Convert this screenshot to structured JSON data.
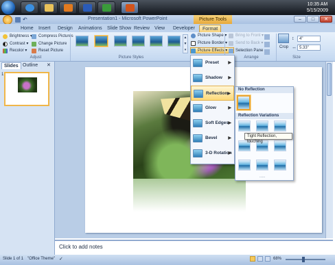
{
  "taskbar": {
    "time": "10:35 AM",
    "date": "5/15/2009"
  },
  "window": {
    "title": "Presentation1 - Microsoft PowerPoint",
    "contextual_tab_group": "Picture Tools"
  },
  "tabs": [
    {
      "label": "Home"
    },
    {
      "label": "Insert"
    },
    {
      "label": "Design"
    },
    {
      "label": "Animations"
    },
    {
      "label": "Slide Show"
    },
    {
      "label": "Review"
    },
    {
      "label": "View"
    },
    {
      "label": "Developer"
    },
    {
      "label": "Format"
    }
  ],
  "ribbon": {
    "adjust": {
      "brightness": "Brightness",
      "contrast": "Contrast",
      "recolor": "Recolor",
      "compress": "Compress Pictures",
      "change": "Change Picture",
      "reset": "Reset Picture",
      "label": "Adjust"
    },
    "styles": {
      "label": "Picture Styles",
      "shape": "Picture Shape",
      "border": "Picture Border",
      "effects": "Picture Effects"
    },
    "arrange": {
      "label": "Arrange",
      "bring": "Bring to Front",
      "send": "Send to Back",
      "selection": "Selection Pane"
    },
    "size": {
      "label": "Size",
      "crop": "Crop",
      "height": "4\"",
      "width": "5.33\""
    }
  },
  "panes": {
    "slides_tab": "Slides",
    "outline_tab": "Outline",
    "slide_number": "1"
  },
  "effects_menu": [
    {
      "label": "Preset"
    },
    {
      "label": "Shadow"
    },
    {
      "label": "Reflection"
    },
    {
      "label": "Glow"
    },
    {
      "label": "Soft Edges"
    },
    {
      "label": "Bevel"
    },
    {
      "label": "3-D Rotation"
    }
  ],
  "reflection_submenu": {
    "no_reflection": "No Reflection",
    "variations": "Reflection Variations",
    "tooltip": "Tight Reflection, touching",
    "more": "....."
  },
  "notes": {
    "placeholder": "Click to add notes"
  },
  "status": {
    "slide": "Slide 1 of 1",
    "theme": "\"Office Theme\"",
    "zoom": "68%"
  }
}
